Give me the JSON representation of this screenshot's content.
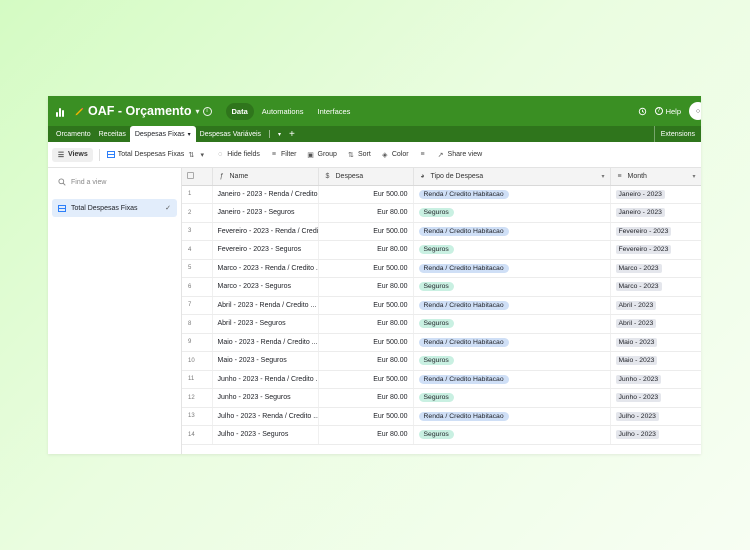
{
  "app": {
    "base_title": "OAF - Orçamento",
    "nav": [
      "Data",
      "Automations",
      "Interfaces"
    ],
    "help_label": "Help"
  },
  "tabs": {
    "items": [
      "Orcamento",
      "Receitas",
      "Despesas Fixas",
      "Despesas Variáveis"
    ],
    "active": "Despesas Fixas",
    "extensions_label": "Extensions"
  },
  "toolbar": {
    "views_label": "Views",
    "view_name": "Total Despesas Fixas",
    "hide_fields": "Hide fields",
    "filter": "Filter",
    "group": "Group",
    "sort": "Sort",
    "color": "Color",
    "share_view": "Share view"
  },
  "sidebar": {
    "find_placeholder": "Find a view",
    "views": [
      "Total Despesas Fixas"
    ]
  },
  "table": {
    "columns": [
      "Name",
      "Despesa",
      "Tipo de Despesa",
      "Month"
    ],
    "rows": [
      {
        "n": "1",
        "name": "Janeiro - 2023 - Renda / Credito ...",
        "despesa": "Eur 500.00",
        "tipo": "Renda / Credito Habitacao",
        "month": "Janeiro - 2023"
      },
      {
        "n": "2",
        "name": "Janeiro - 2023 - Seguros",
        "despesa": "Eur 80.00",
        "tipo": "Seguros",
        "month": "Janeiro - 2023"
      },
      {
        "n": "3",
        "name": "Fevereiro - 2023 - Renda / Credi...",
        "despesa": "Eur 500.00",
        "tipo": "Renda / Credito Habitacao",
        "month": "Fevereiro - 2023"
      },
      {
        "n": "4",
        "name": "Fevereiro - 2023 - Seguros",
        "despesa": "Eur 80.00",
        "tipo": "Seguros",
        "month": "Fevereiro - 2023"
      },
      {
        "n": "5",
        "name": "Marco - 2023 - Renda / Credito ...",
        "despesa": "Eur 500.00",
        "tipo": "Renda / Credito Habitacao",
        "month": "Marco - 2023"
      },
      {
        "n": "6",
        "name": "Marco - 2023 - Seguros",
        "despesa": "Eur 80.00",
        "tipo": "Seguros",
        "month": "Marco - 2023"
      },
      {
        "n": "7",
        "name": "Abril - 2023 - Renda / Credito ...",
        "despesa": "Eur 500.00",
        "tipo": "Renda / Credito Habitacao",
        "month": "Abril - 2023"
      },
      {
        "n": "8",
        "name": "Abril - 2023 - Seguros",
        "despesa": "Eur 80.00",
        "tipo": "Seguros",
        "month": "Abril - 2023"
      },
      {
        "n": "9",
        "name": "Maio - 2023 - Renda / Credito ...",
        "despesa": "Eur 500.00",
        "tipo": "Renda / Credito Habitacao",
        "month": "Maio - 2023"
      },
      {
        "n": "10",
        "name": "Maio - 2023 - Seguros",
        "despesa": "Eur 80.00",
        "tipo": "Seguros",
        "month": "Maio - 2023"
      },
      {
        "n": "11",
        "name": "Junho - 2023 - Renda / Credito ...",
        "despesa": "Eur 500.00",
        "tipo": "Renda / Credito Habitacao",
        "month": "Junho - 2023"
      },
      {
        "n": "12",
        "name": "Junho - 2023 - Seguros",
        "despesa": "Eur 80.00",
        "tipo": "Seguros",
        "month": "Junho - 2023"
      },
      {
        "n": "13",
        "name": "Julho - 2023 - Renda / Credito ...",
        "despesa": "Eur 500.00",
        "tipo": "Renda / Credito Habitacao",
        "month": "Julho - 2023"
      },
      {
        "n": "14",
        "name": "Julho - 2023 - Seguros",
        "despesa": "Eur 80.00",
        "tipo": "Seguros",
        "month": "Julho - 2023"
      }
    ]
  },
  "colors": {
    "header_green": "#3a8f23",
    "tabs_green": "#2f751c",
    "renda_pill": "#cfdff6",
    "seguros_pill": "#c9f0e2"
  }
}
